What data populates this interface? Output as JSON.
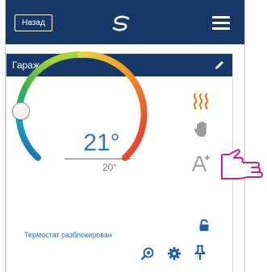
{
  "header": {
    "back_label": "Назад",
    "logo_icon": "swirl-logo-icon",
    "menu_icon": "hamburger-menu-icon"
  },
  "card": {
    "title": "Гараж",
    "edit_icon": "pencil-icon"
  },
  "thermostat": {
    "current_temp": "21°",
    "set_temp": "20°",
    "knob_level": 0.2,
    "mode_icons": [
      "heating-icon",
      "manual-hand-icon",
      "auto-a-plus-icon"
    ],
    "status_text": "Термостат разблокирован",
    "lock_icon": "unlocked-padlock-icon"
  },
  "footer_icons": [
    "search-zoom-icon",
    "settings-gear-icon",
    "pin-icon"
  ],
  "colors": {
    "primary": "#17396a",
    "accent_blue": "#2e79c4",
    "heating": "#f07b1e",
    "pointer": "#d81b8c"
  }
}
